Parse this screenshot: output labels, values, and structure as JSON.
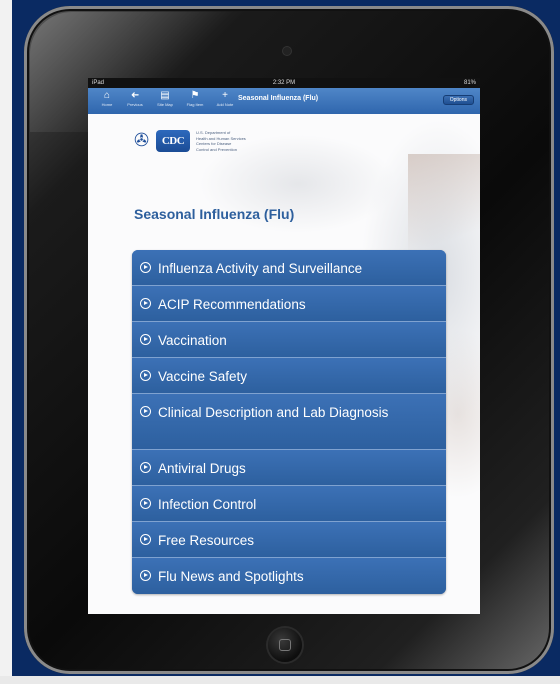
{
  "status_bar": {
    "device": "iPad",
    "time": "2:32 PM",
    "battery": "81%"
  },
  "toolbar": {
    "buttons": [
      {
        "label": "Home",
        "icon": "home-icon",
        "glyph": "⌂"
      },
      {
        "label": "Previous",
        "icon": "back-arrow-icon",
        "glyph": "➜"
      },
      {
        "label": "Site Map",
        "icon": "sitemap-icon",
        "glyph": "▤"
      },
      {
        "label": "Flag Item",
        "icon": "flag-icon",
        "glyph": "⚑"
      },
      {
        "label": "Add Note",
        "icon": "add-icon",
        "glyph": "+"
      }
    ],
    "title": "Seasonal Influenza (Flu)",
    "options_label": "Options"
  },
  "header": {
    "logo_text": "CDC",
    "department_lines": [
      "U.S. Department of",
      "Health and Human Services",
      "Centers for Disease",
      "Control and Prevention"
    ]
  },
  "page_title": "Seasonal Influenza (Flu)",
  "menu_items": [
    {
      "label": "Influenza Activity and Surveillance"
    },
    {
      "label": "ACIP Recommendations"
    },
    {
      "label": "Vaccination"
    },
    {
      "label": "Vaccine Safety"
    },
    {
      "label": "Clinical Description and Lab Diagnosis"
    },
    {
      "label": "Antiviral Drugs"
    },
    {
      "label": "Infection Control"
    },
    {
      "label": "Free Resources"
    },
    {
      "label": "Flu News and Spotlights"
    }
  ],
  "colors": {
    "background": "#0a2a62",
    "navbar": "#2f66ad",
    "menu": "#2f62a6",
    "title": "#2d5f9d"
  }
}
